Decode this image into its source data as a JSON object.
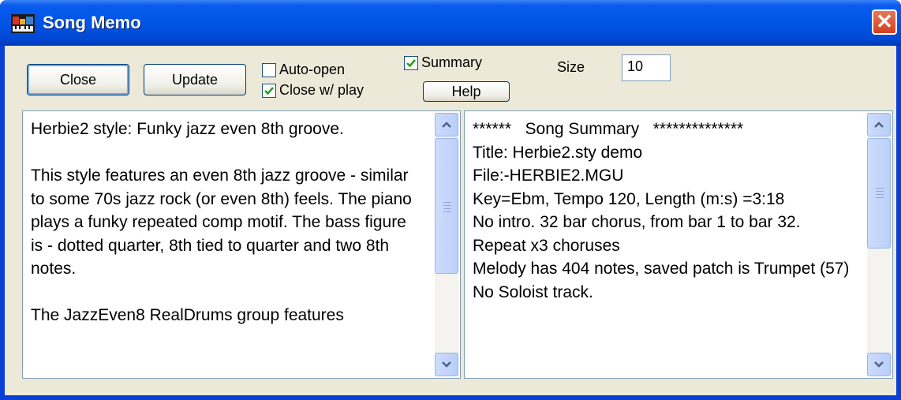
{
  "window": {
    "title": "Song Memo"
  },
  "toolbar": {
    "close_label": "Close",
    "update_label": "Update",
    "auto_open_label": "Auto-open",
    "auto_open_checked": false,
    "close_w_play_label": "Close w/ play",
    "close_w_play_checked": true,
    "summary_label": "Summary",
    "summary_checked": true,
    "help_label": "Help",
    "size_label": "Size",
    "size_value": "10"
  },
  "memo": {
    "text": "Herbie2 style: Funky jazz even 8th groove.\n\nThis style features an even 8th jazz groove - similar to some 70s jazz rock (or even 8th) feels. The piano plays a funky repeated comp motif. The bass figure is - dotted quarter, 8th tied to quarter and two 8th notes.\n\nThe JazzEven8 RealDrums group features"
  },
  "summary": {
    "lines": [
      "******   Song Summary   **************",
      "Title: Herbie2.sty demo",
      "File:-HERBIE2.MGU",
      "Key=Ebm, Tempo 120, Length (m:s) =3:18",
      "No intro. 32 bar chorus, from bar 1 to bar 32.  Repeat x3 choruses",
      "Melody has 404 notes, saved patch is Trumpet (57)",
      "No Soloist track."
    ]
  },
  "colors": {
    "titlebar": "#0055e5",
    "dialog_bg": "#ece9d8",
    "close_button": "#d2401f",
    "check_mark": "#21a121"
  }
}
